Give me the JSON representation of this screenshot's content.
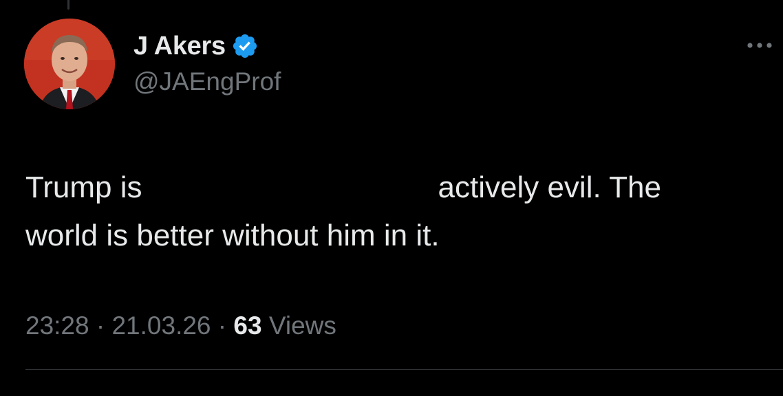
{
  "author": {
    "display_name": "J Akers",
    "handle": "@JAEngProf",
    "verified": true,
    "avatar_icon": "profile-photo",
    "verified_icon": "verified-badge-icon"
  },
  "tweet": {
    "line1_start": "Trump is",
    "line1_end": "actively evil.  The",
    "line2": "world is better without him in it."
  },
  "meta": {
    "time": "23:28",
    "date": "21.03.26",
    "separator": "·",
    "views_count": "63",
    "views_label": "Views"
  },
  "colors": {
    "background": "#000000",
    "primary_text": "#e7e9ea",
    "secondary_text": "#71767b",
    "verified": "#1d9bf0",
    "divider": "#2f3336"
  }
}
